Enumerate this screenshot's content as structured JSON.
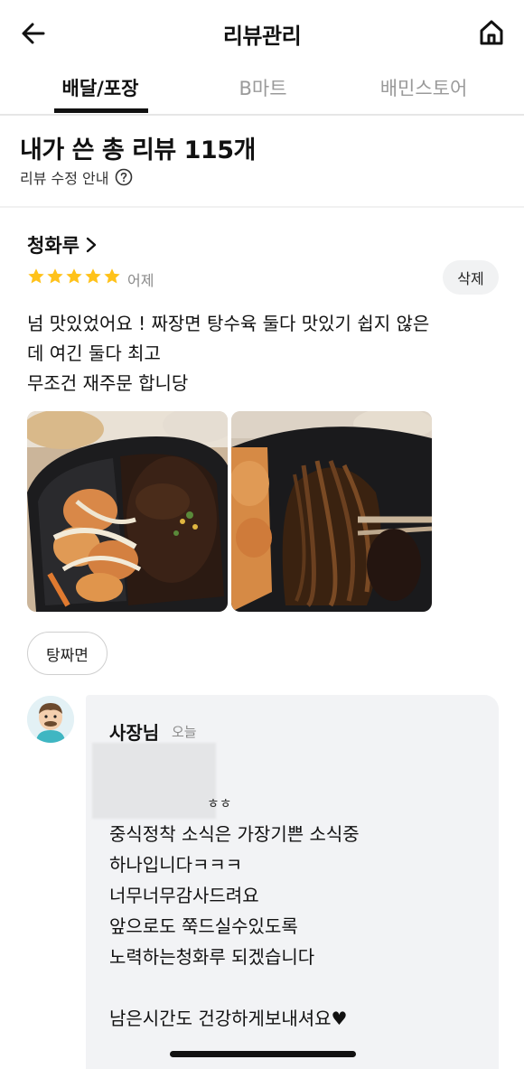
{
  "header": {
    "title": "리뷰관리",
    "back_icon": "arrow-left-icon",
    "home_icon": "home-icon"
  },
  "tabs": [
    {
      "label": "배달/포장",
      "active": true
    },
    {
      "label": "B마트",
      "active": false
    },
    {
      "label": "배민스토어",
      "active": false
    }
  ],
  "summary": {
    "title": "내가 쓴 총 리뷰 115개",
    "edit_guide": "리뷰 수정 안내",
    "help_icon": "question-circle-icon"
  },
  "review": {
    "store_name": "청화루",
    "rating": 5,
    "max_rating": 5,
    "date": "어제",
    "delete_label": "삭제",
    "text_lines": [
      "넘 맛있었어요 ! 짜장면 탕수육 둘다 맛있기 쉽지 않은",
      "데 여긴 둘다 최고",
      "무조건 재주문 합니당"
    ],
    "photos": [
      {
        "description_icon": "food-photo-tangsuyuk-icon"
      },
      {
        "description_icon": "food-photo-jjajangmyeon-icon"
      }
    ],
    "menu_chip": "탕짜면"
  },
  "owner_reply": {
    "name": "사장님",
    "date": "오늘",
    "first_line_tail": "ㅎㅎ",
    "lines": [
      "중식정착 소식은 가장기쁜 소식중",
      "하나입니다ㅋㅋㅋ",
      "너무너무감사드려요",
      "앞으로도 쭉드실수있도록",
      "노력하는청화루 되겠습니다",
      "",
      "남은시간도 건강하게보내셔요♥"
    ]
  },
  "colors": {
    "star": "#ffc21a",
    "accent": "#111111",
    "bubble": "#f2f3f5"
  }
}
